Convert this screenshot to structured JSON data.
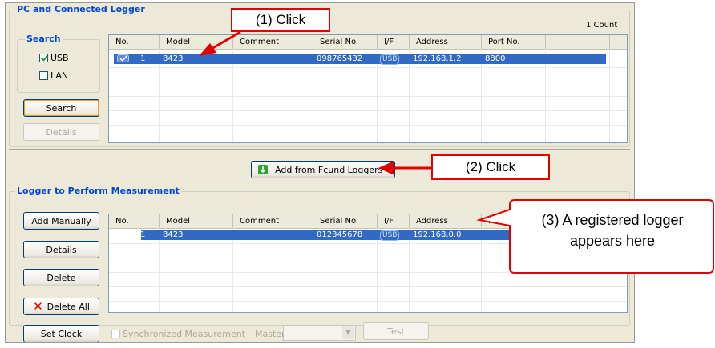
{
  "pc_panel": {
    "title": "PC and Connected Logger",
    "count": "1 Count",
    "search_group": {
      "title": "Search",
      "usb_label": "USB",
      "usb_checked": true,
      "lan_label": "LAN",
      "lan_checked": false
    },
    "search_button": "Search",
    "details_button": "Details",
    "columns": [
      "No.",
      "Model",
      "Comment",
      "Serial No.",
      "I/F",
      "Address",
      "Port No."
    ],
    "rows": [
      {
        "no": "1",
        "model": "8423",
        "comment": "",
        "serial": "098765432",
        "if": "USB",
        "address": "192.168.1.2",
        "port": "8800"
      }
    ]
  },
  "add_button": "Add from Fcund Loggers",
  "measure_panel": {
    "title": "Logger to Perform Measurement",
    "add_manually_button": "Add Manually",
    "details_button": "Details",
    "delete_button": "Delete",
    "delete_all_button": "Delete All",
    "columns": [
      "No.",
      "Model",
      "Comment",
      "Serial No.",
      "I/F",
      "Address",
      "Port"
    ],
    "rows": [
      {
        "no": "1",
        "model": "8423",
        "comment": "",
        "serial": "012345678",
        "if": "USB",
        "address": "192.168.0.0"
      }
    ]
  },
  "bottom_bar": {
    "set_clock_button": "Set Clock",
    "sync_label": "Synchronized Measurement",
    "master_label": "Master",
    "test_button": "Test"
  },
  "callouts": {
    "c1": "(1) Click",
    "c2": "(2) Click",
    "c3_line1": "(3) A registered logger",
    "c3_line2": "appears here"
  },
  "colors": {
    "selection": "#316ac5",
    "callout": "#e00000",
    "title": "#0046d5"
  }
}
